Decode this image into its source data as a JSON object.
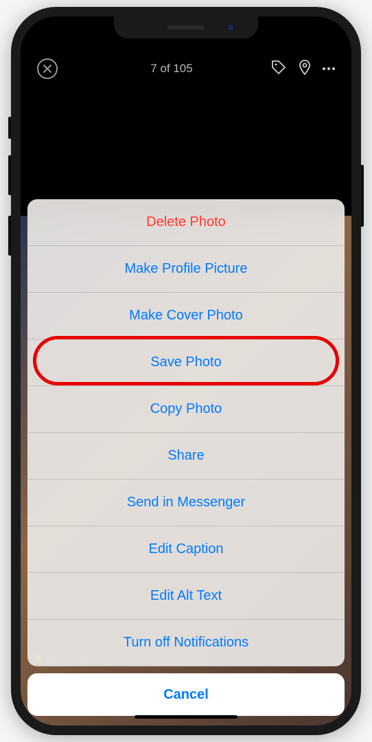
{
  "header": {
    "counter": "7 of 105"
  },
  "actions": {
    "delete": "Delete Photo",
    "profile": "Make Profile Picture",
    "cover": "Make Cover Photo",
    "save": "Save Photo",
    "copy": "Copy Photo",
    "share": "Share",
    "messenger": "Send in Messenger",
    "caption": "Edit Caption",
    "alttext": "Edit Alt Text",
    "notifications": "Turn off Notifications"
  },
  "cancel": "Cancel",
  "tag": "Tania Kaqui"
}
